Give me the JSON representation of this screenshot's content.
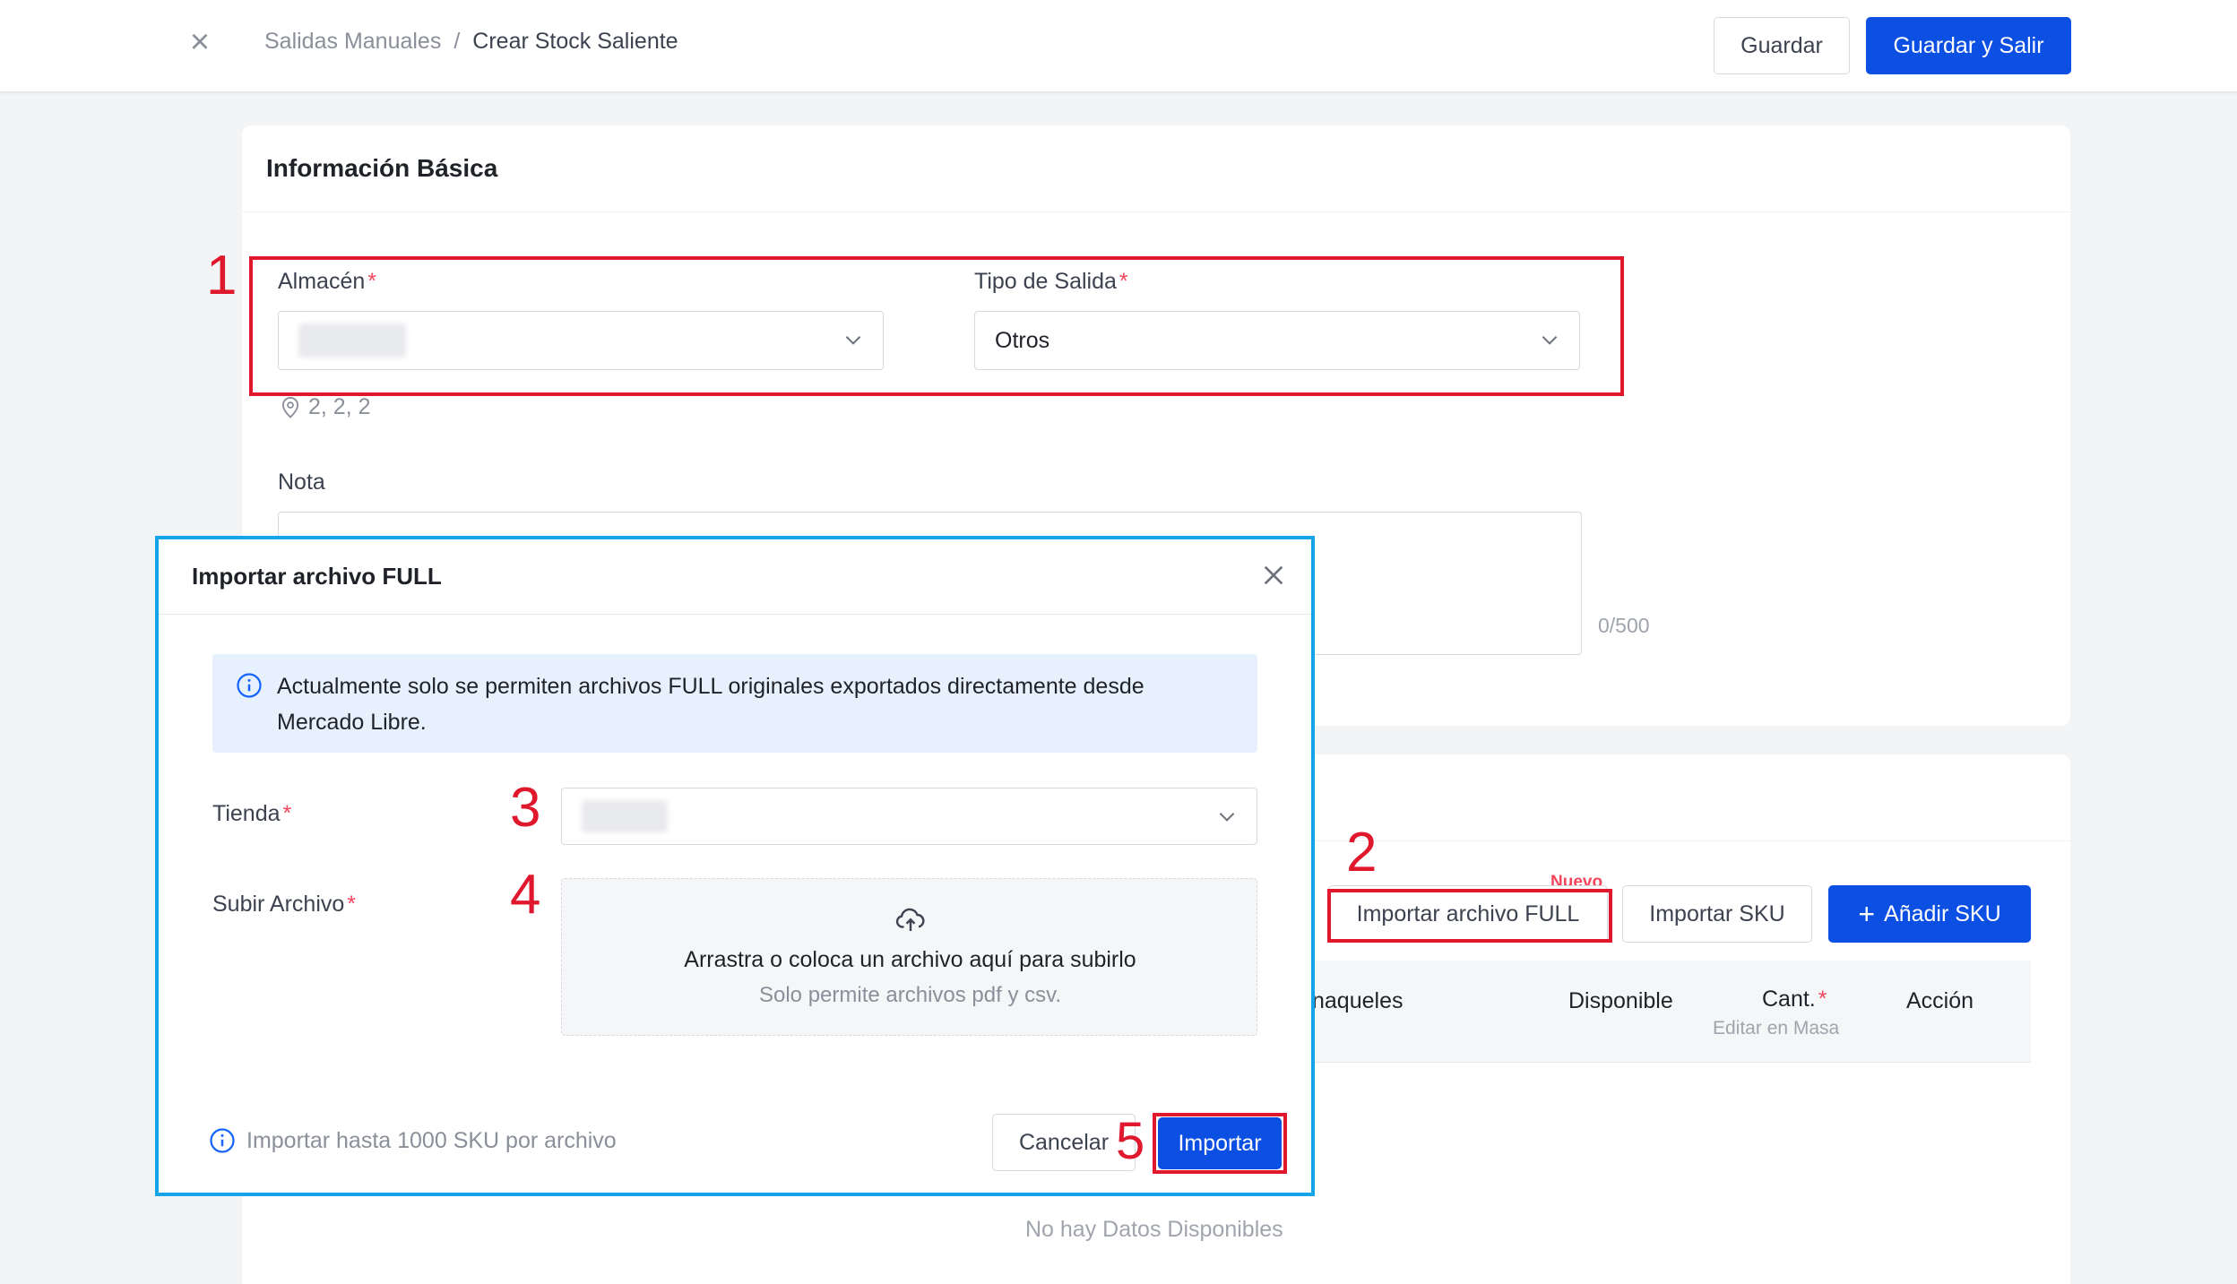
{
  "header": {
    "breadcrumb_parent": "Salidas Manuales",
    "breadcrumb_separator": "/",
    "breadcrumb_current": "Crear Stock Saliente",
    "save_label": "Guardar",
    "save_exit_label": "Guardar y Salir"
  },
  "basic_info": {
    "title": "Información Básica",
    "warehouse_label": "Almacén",
    "exit_type_label": "Tipo de Salida",
    "exit_type_value": "Otros",
    "location_text": "2, 2, 2",
    "note_label": "Nota",
    "note_counter": "0/500"
  },
  "sku_section": {
    "new_badge": "Nuevo",
    "import_full_label": "Importar archivo FULL",
    "import_sku_label": "Importar SKU",
    "add_sku_label": "Añadir SKU",
    "columns": {
      "shelves": "naqueles",
      "available": "Disponible",
      "quantity": "Cant.",
      "bulk_edit": "Editar en Masa",
      "action": "Acción"
    },
    "empty_text": "No hay Datos Disponibles"
  },
  "annotations": {
    "n1": "1",
    "n2": "2",
    "n3": "3",
    "n4": "4",
    "n5": "5"
  },
  "modal": {
    "title": "Importar archivo FULL",
    "info_text": "Actualmente solo se permiten archivos FULL originales exportados directamente desde Mercado Libre.",
    "store_label": "Tienda",
    "upload_label": "Subir Archivo",
    "upload_main": "Arrastra o coloca un archivo aquí para subirlo",
    "upload_sub": "Solo permite archivos pdf y csv.",
    "footer_info": "Importar hasta 1000 SKU por archivo",
    "cancel_label": "Cancelar",
    "import_label": "Importar"
  },
  "colors": {
    "primary": "#0b4fe3",
    "annotation_red": "#e0182d",
    "modal_border": "#13a5e8",
    "required_star": "#f5455c"
  }
}
